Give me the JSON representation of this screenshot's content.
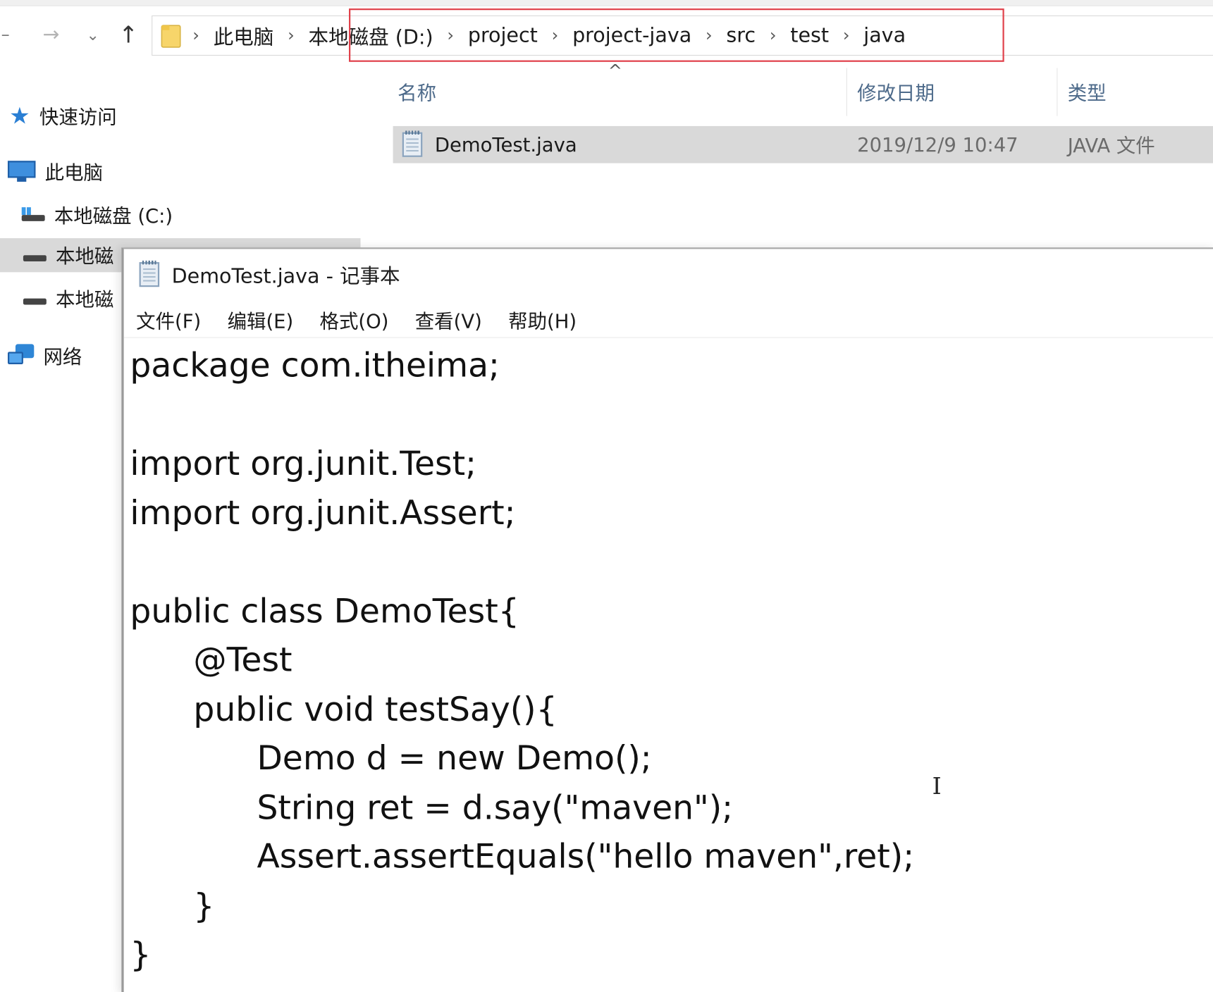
{
  "explorer": {
    "address_bar": {
      "breadcrumbs": [
        "此电脑",
        "本地磁盘 (D:)",
        "project",
        "project-java",
        "src",
        "test",
        "java"
      ]
    },
    "nav_pane": {
      "quick_access": "快速访问",
      "this_pc": "此电脑",
      "drive_c": "本地磁盘 (C:)",
      "drive_d_partial": "本地磁",
      "drive_e_partial": "本地磁",
      "network": "网络"
    },
    "columns": {
      "name": "名称",
      "date": "修改日期",
      "type": "类型"
    },
    "files": [
      {
        "name": "DemoTest.java",
        "date": "2019/12/9 10:47",
        "type": "JAVA 文件"
      }
    ],
    "highlight_color": "#e0404a",
    "selected_row_color": "#d9d9d9"
  },
  "notepad": {
    "title": "DemoTest.java - 记事本",
    "menu": [
      "文件(F)",
      "编辑(E)",
      "格式(O)",
      "查看(V)",
      "帮助(H)"
    ],
    "content": "package com.itheima;\n\nimport org.junit.Test;\nimport org.junit.Assert;\n\npublic class DemoTest{\n\t@Test\n\tpublic void testSay(){\n\t\tDemo d = new Demo();\n\t\tString ret = d.say(\"maven\");\n\t\tAssert.assertEquals(\"hello maven\",ret);\n\t}\n}"
  }
}
